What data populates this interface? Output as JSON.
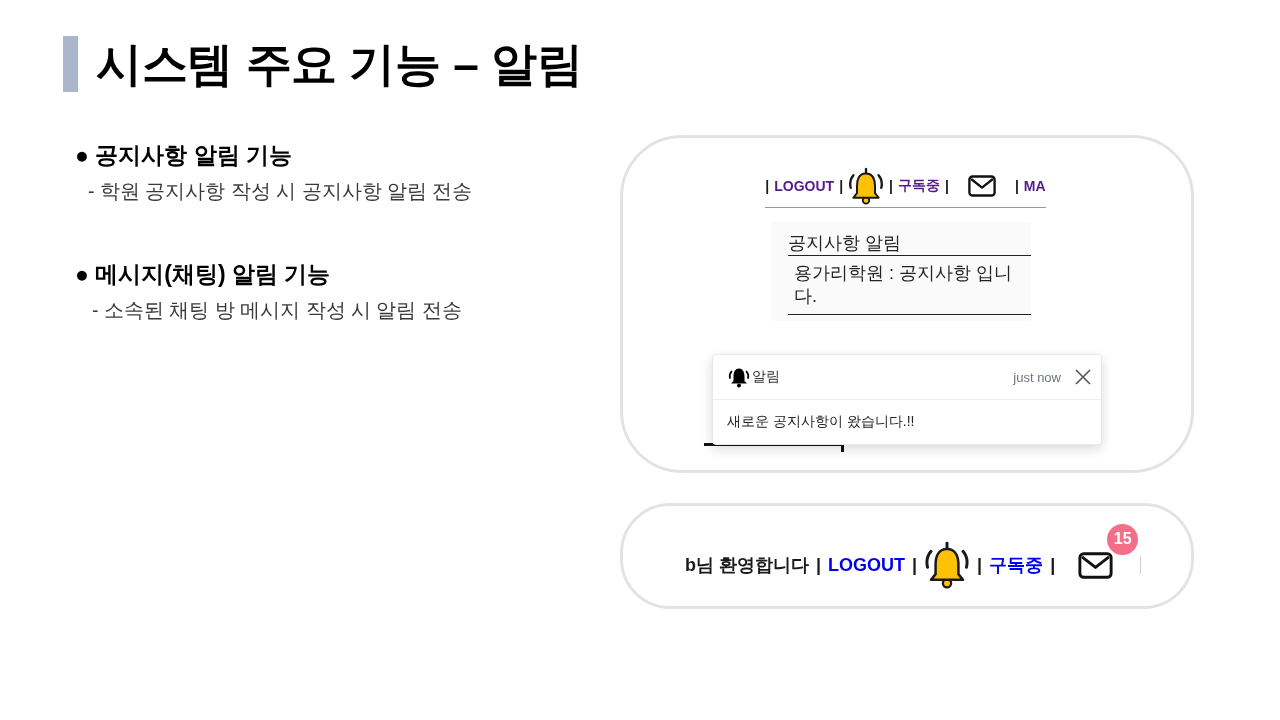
{
  "title": "시스템 주요 기능 – 알림",
  "features": [
    {
      "heading": "● 공지사항 알림 기능",
      "description": "- 학원 공지사항 작성 시 공지사항 알림 전송"
    },
    {
      "heading": "● 메시지(채팅) 알림 기능",
      "description": "- 소속된 채팅 방 메시지 작성 시 알림 전송"
    }
  ],
  "notice_preview": {
    "nav": [
      {
        "kind": "separator",
        "text": "|"
      },
      {
        "kind": "link",
        "text": "LOGOUT",
        "visited": true
      },
      {
        "kind": "separator",
        "text": "|"
      },
      {
        "kind": "bell"
      },
      {
        "kind": "separator",
        "text": "|"
      },
      {
        "kind": "link",
        "text": "구독중",
        "visited": true
      },
      {
        "kind": "separator",
        "text": "|"
      },
      {
        "kind": "mail"
      },
      {
        "kind": "separator",
        "text": "|"
      },
      {
        "kind": "link",
        "text": "MA",
        "visited": true
      }
    ],
    "notice": {
      "title": "공지사항 알림",
      "message": "용가리학원 : 공지사항 입니다."
    },
    "toast": {
      "title": "알림",
      "time": "just now",
      "message": "새로운 공지사항이 왔습니다.!!"
    }
  },
  "header_preview": {
    "nav": [
      {
        "kind": "text",
        "text": "b님 환영합니다"
      },
      {
        "kind": "separator",
        "text": "|"
      },
      {
        "kind": "link",
        "text": "LOGOUT",
        "visited": false
      },
      {
        "kind": "separator",
        "text": "|"
      },
      {
        "kind": "bell"
      },
      {
        "kind": "separator",
        "text": "|"
      },
      {
        "kind": "link",
        "text": "구독중",
        "visited": false
      },
      {
        "kind": "separator",
        "text": "|"
      },
      {
        "kind": "mail",
        "badge": "15"
      },
      {
        "kind": "rule"
      }
    ]
  }
}
